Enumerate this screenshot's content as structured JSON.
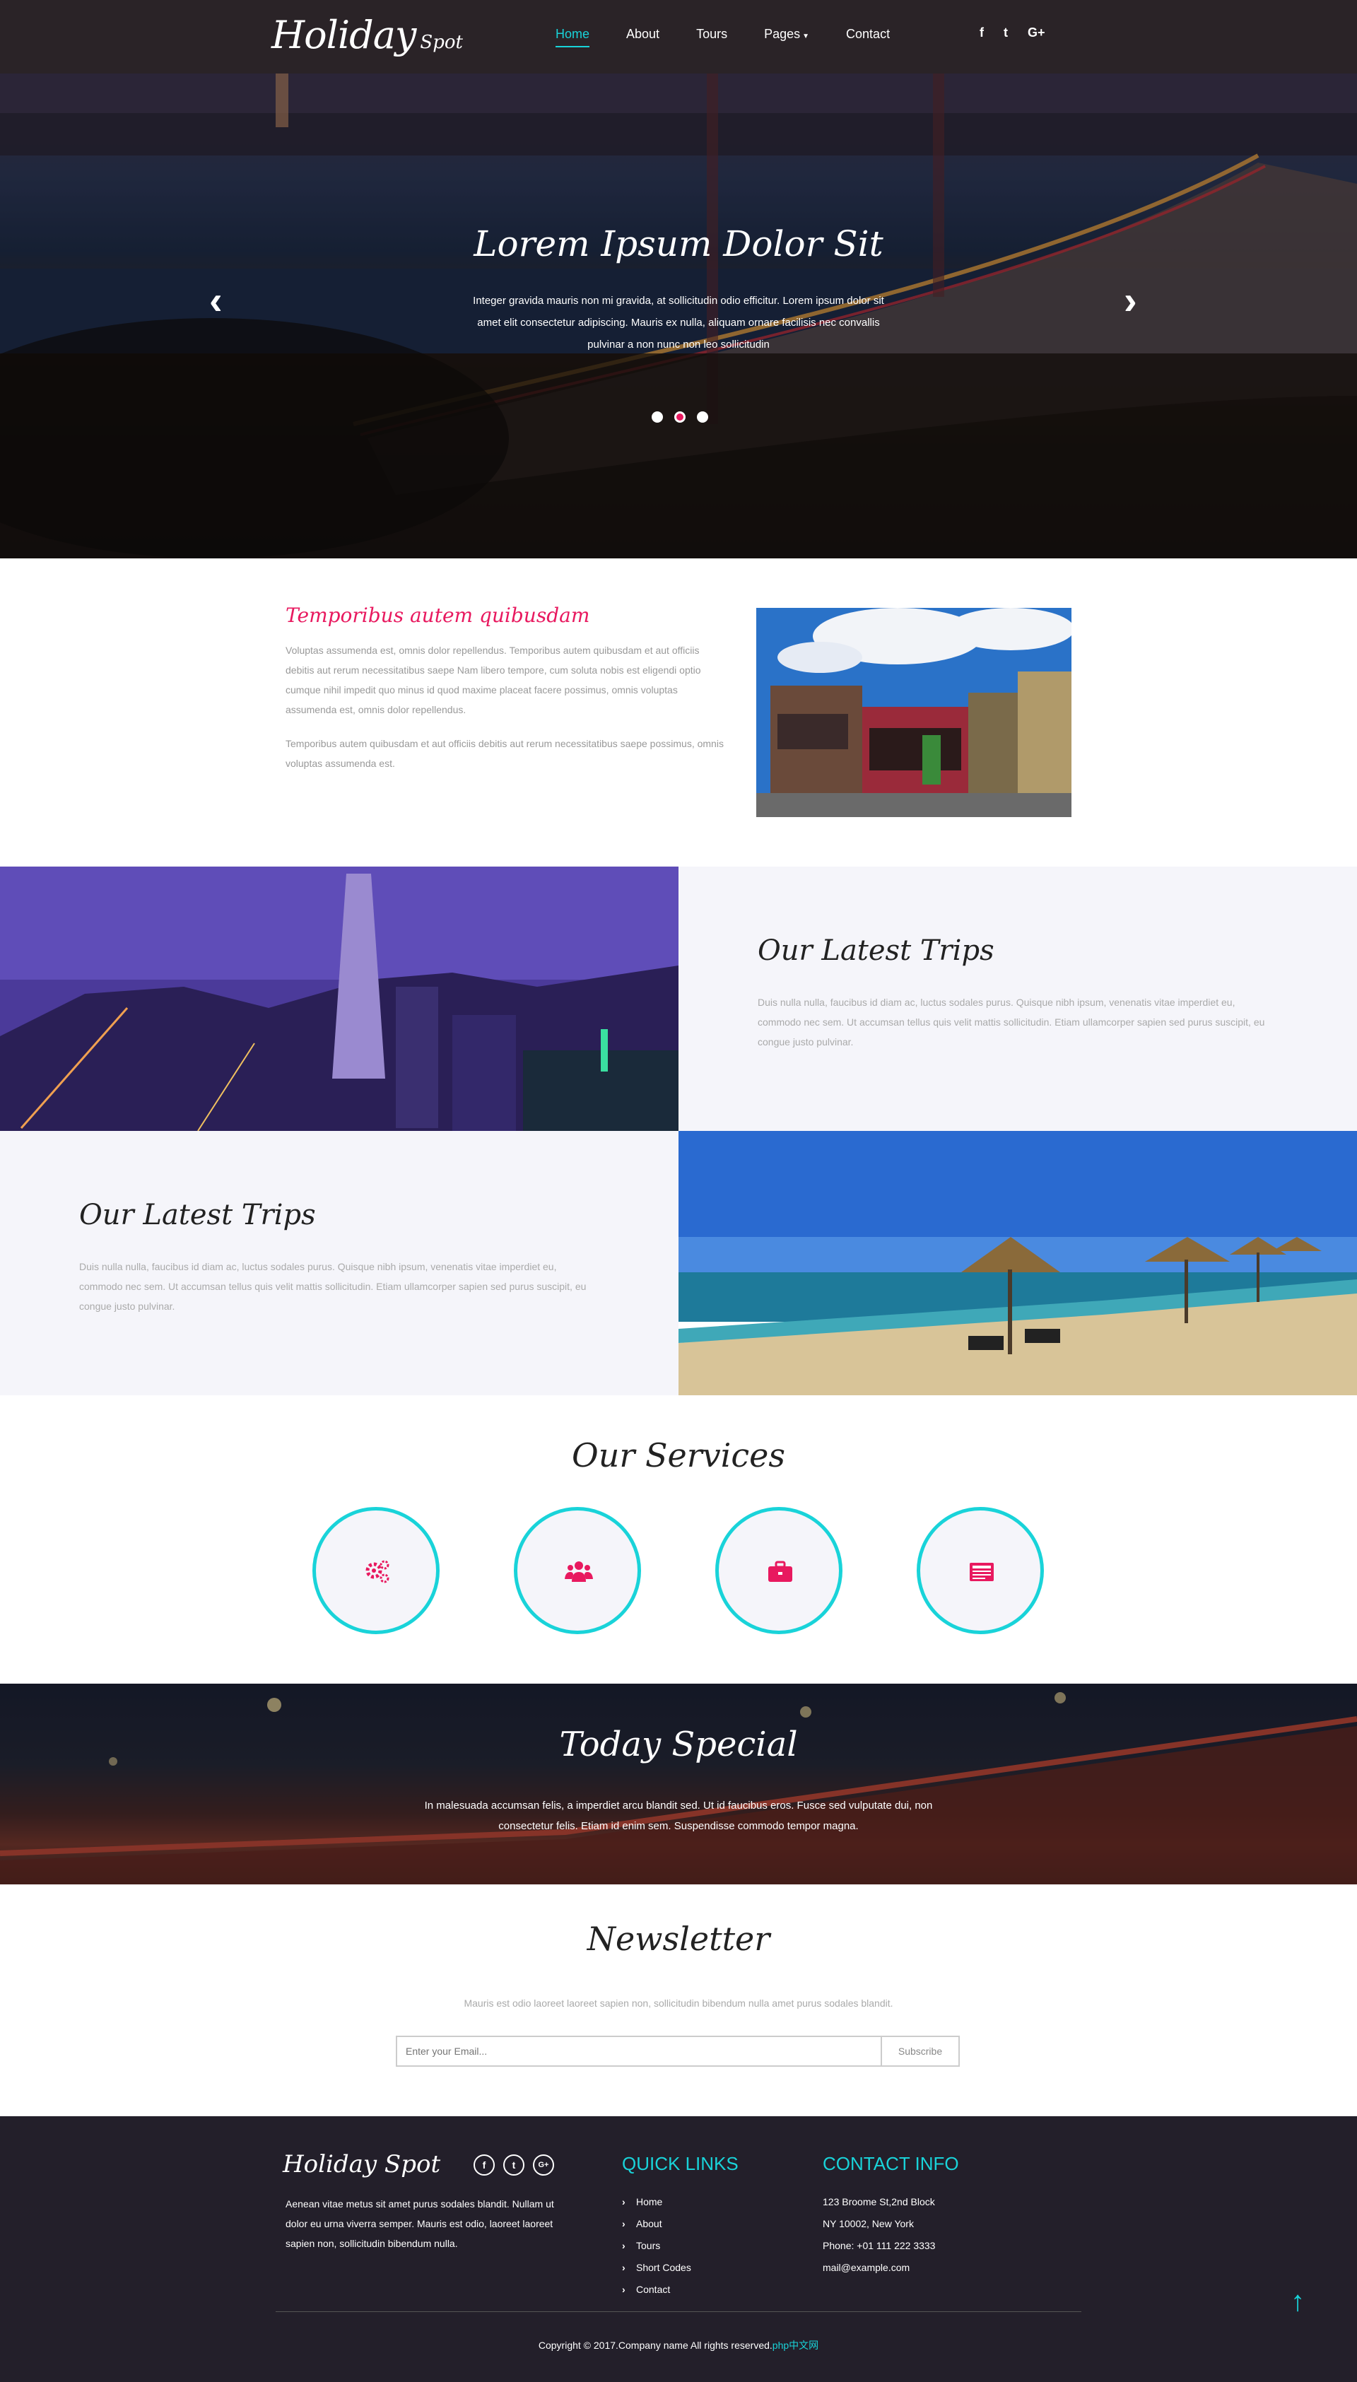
{
  "nav": {
    "logo_main": "Holiday",
    "logo_sub": "Spot",
    "items": [
      "Home",
      "About",
      "Tours",
      "Pages",
      "Contact"
    ],
    "active": "Home",
    "socials": [
      "f",
      "t",
      "G+"
    ]
  },
  "hero": {
    "title": "Lorem Ipsum Dolor Sit",
    "text": "Integer gravida mauris non mi gravida, at sollicitudin odio efficitur. Lorem ipsum dolor sit amet elit consectetur adipiscing. Mauris ex nulla, aliquam ornare facilisis nec convallis pulvinar a non nunc non leo sollicitudin",
    "slide_count": 3,
    "active_slide": 2,
    "prev_icon": "chevron-left-icon",
    "next_icon": "chevron-right-icon"
  },
  "about": {
    "heading": "Temporibus autem quibusdam",
    "p1": "Voluptas assumenda est, omnis dolor repellendus. Temporibus autem quibusdam et aut officiis debitis aut rerum necessitatibus saepe Nam libero tempore, cum soluta nobis est eligendi optio cumque nihil impedit quo minus id quod maxime placeat facere possimus, omnis voluptas assumenda est, omnis dolor repellendus.",
    "p2": "Temporibus autem quibusdam et aut officiis debitis aut rerum necessitatibus saepe possimus, omnis voluptas assumenda est."
  },
  "trips": [
    {
      "title": "Our Latest Trips",
      "text": "Duis nulla nulla, faucibus id diam ac, luctus sodales purus. Quisque nibh ipsum, venenatis vitae imperdiet eu, commodo nec sem. Ut accumsan tellus quis velit mattis sollicitudin. Etiam ullamcorper sapien sed purus suscipit, eu congue justo pulvinar."
    },
    {
      "title": "Our Latest Trips",
      "text": "Duis nulla nulla, faucibus id diam ac, luctus sodales purus. Quisque nibh ipsum, venenatis vitae imperdiet eu, commodo nec sem. Ut accumsan tellus quis velit mattis sollicitudin. Etiam ullamcorper sapien sed purus suscipit, eu congue justo pulvinar."
    }
  ],
  "services": {
    "title": "Our Services",
    "icons": [
      "gears-icon",
      "users-icon",
      "briefcase-icon",
      "newspaper-icon"
    ]
  },
  "special": {
    "title": "Today Special",
    "text": "In malesuada accumsan felis, a imperdiet arcu blandit sed. Ut id faucibus eros. Fusce sed vulputate dui, non consectetur felis. Etiam id enim sem. Suspendisse commodo tempor magna."
  },
  "newsletter": {
    "title": "Newsletter",
    "text": "Mauris est odio laoreet laoreet sapien non, sollicitudin bibendum nulla amet purus sodales blandit.",
    "placeholder": "Enter your Email...",
    "button": "Subscribe"
  },
  "footer": {
    "logo": "Holiday Spot",
    "socials": [
      "f",
      "t",
      "G+"
    ],
    "description": "Aenean vitae metus sit amet purus sodales blandit. Nullam ut dolor eu urna viverra semper. Mauris est odio, laoreet laoreet sapien non, sollicitudin bibendum nulla.",
    "quick_links_title": "QUICK LINKS",
    "quick_links": [
      "Home",
      "About",
      "Tours",
      "Short Codes",
      "Contact"
    ],
    "contact_title": "CONTACT INFO",
    "contact_lines": [
      "123 Broome St,2nd Block",
      "NY 10002, New York",
      "Phone: +01 111 222 3333",
      "mail@example.com"
    ],
    "copyright": "Copyright © 2017.Company name All rights reserved.",
    "copyright_link": "php中文网"
  },
  "colors": {
    "accent": "#19d3d9",
    "pink": "#e8195f",
    "nav_bg": "#2a2327",
    "footer_bg": "#231f2a"
  }
}
